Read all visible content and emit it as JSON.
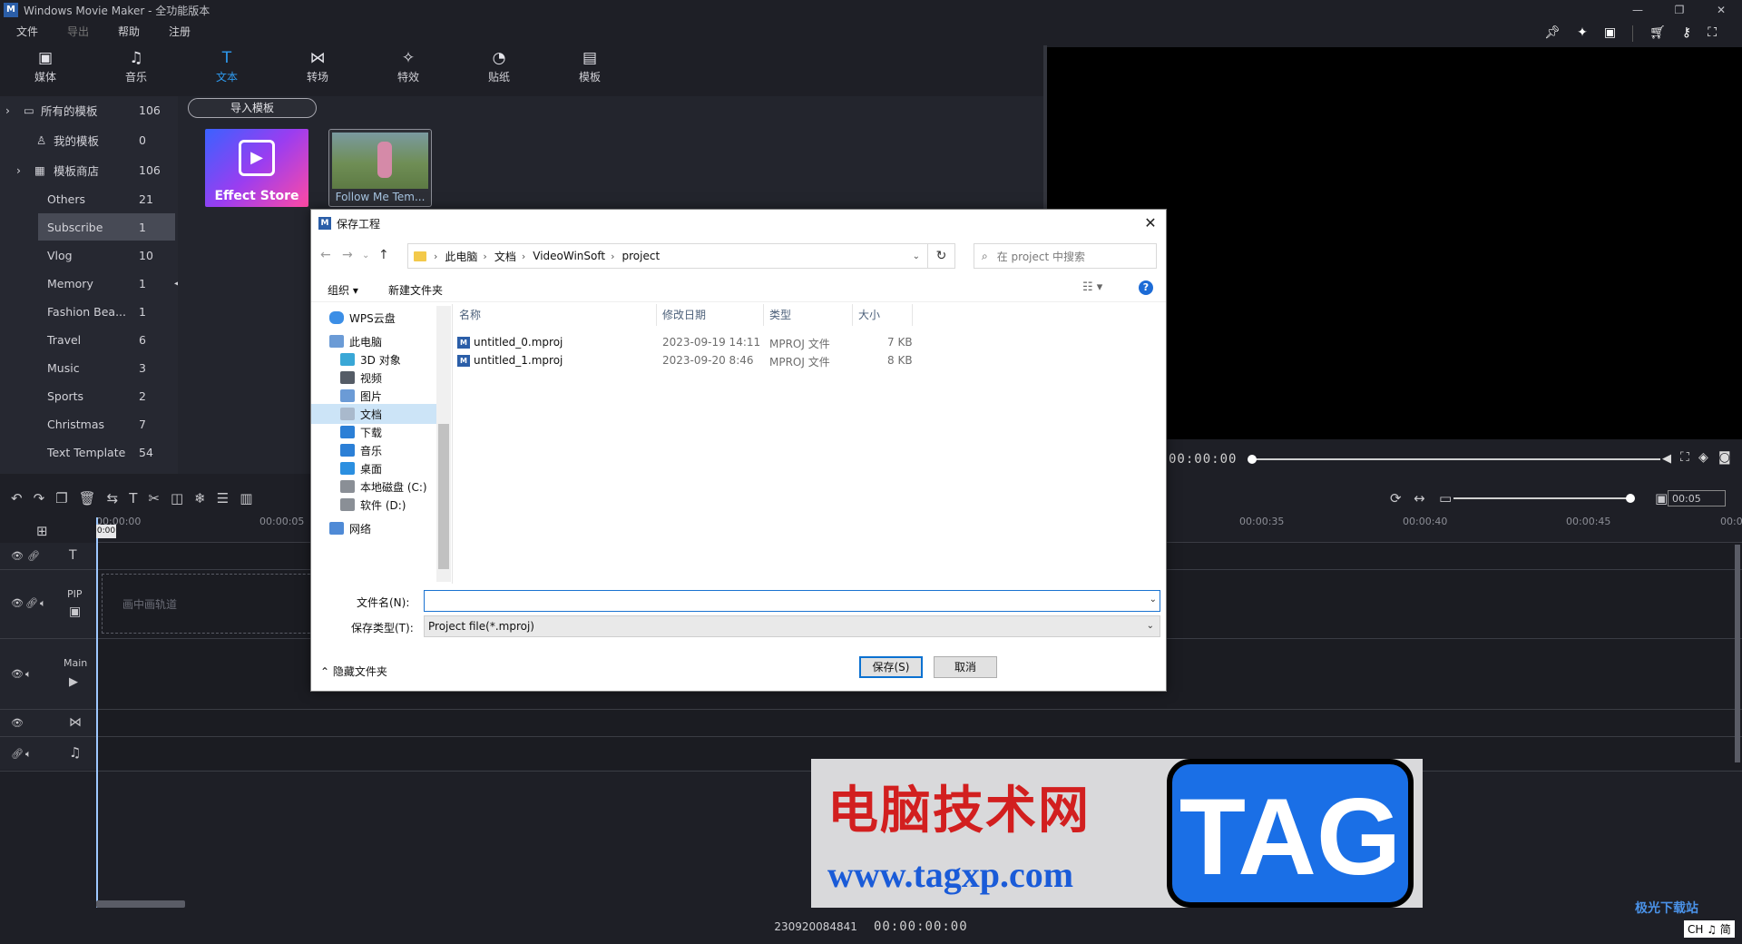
{
  "app": {
    "title": "Windows Movie Maker - 全功能版本",
    "logo": "M",
    "window_buttons": [
      "—",
      "❐",
      "✕"
    ]
  },
  "menu": [
    {
      "label": "文件",
      "enabled": true
    },
    {
      "label": "导出",
      "enabled": false
    },
    {
      "label": "帮助",
      "enabled": true
    },
    {
      "label": "注册",
      "enabled": true
    }
  ],
  "toolbar_icons": [
    "pin-icon",
    "sparkle-icon",
    "save-icon",
    "cart-icon",
    "key-icon",
    "screen-ratio-icon"
  ],
  "tabs": [
    {
      "label": "媒体",
      "icon": "▣",
      "active": false
    },
    {
      "label": "音乐",
      "icon": "♫",
      "active": false
    },
    {
      "label": "文本",
      "icon": "T",
      "active": true
    },
    {
      "label": "转场",
      "icon": "⋈",
      "active": false
    },
    {
      "label": "特效",
      "icon": "✧",
      "active": false
    },
    {
      "label": "贴纸",
      "icon": "◔",
      "active": false
    },
    {
      "label": "模板",
      "icon": "▤",
      "active": false
    }
  ],
  "sidebar": {
    "items": [
      {
        "label": "所有的模板",
        "count": "106",
        "expander": "›",
        "icon": "▭"
      },
      {
        "label": "我的模板",
        "count": "0",
        "expander": "",
        "icon": "♙"
      },
      {
        "label": "模板商店",
        "count": "106",
        "expander": "›",
        "icon": "▦"
      },
      {
        "label": "Others",
        "count": "21"
      },
      {
        "label": "Subscribe",
        "count": "1"
      },
      {
        "label": "Vlog",
        "count": "10"
      },
      {
        "label": "Memory",
        "count": "1"
      },
      {
        "label": "Fashion Bea...",
        "count": "1"
      },
      {
        "label": "Travel",
        "count": "6"
      },
      {
        "label": "Music",
        "count": "3"
      },
      {
        "label": "Sports",
        "count": "2"
      },
      {
        "label": "Christmas",
        "count": "7"
      },
      {
        "label": "Text Template",
        "count": "54"
      }
    ],
    "selected_index": 4
  },
  "content": {
    "import_button": "导入模板",
    "thumbnails": [
      {
        "caption": "Effect Store"
      },
      {
        "caption": "Follow Me Tem..."
      }
    ]
  },
  "preview": {
    "timecode": "00:00:00"
  },
  "timeline": {
    "ruler_labels": [
      "00:00:00",
      "00:00:05",
      "00:00:35",
      "00:00:40",
      "00:00:45",
      "00:0"
    ],
    "playhead_label": "0:00",
    "zoom_value": "00:05",
    "tracks": [
      {
        "label": "",
        "icon": "T"
      },
      {
        "label": "PIP",
        "icon": "▣",
        "placeholder": "画中画轨道"
      },
      {
        "label": "Main",
        "icon": "▶"
      },
      {
        "label": "",
        "icon": "⋈"
      },
      {
        "label": "",
        "icon": "♫"
      }
    ]
  },
  "statusbar": {
    "project_id": "230920084841",
    "timecode": "00:00:00:00"
  },
  "dialog": {
    "title": "保存工程",
    "close": "✕",
    "breadcrumbs": [
      "此电脑",
      "文档",
      "VideoWinSoft",
      "project"
    ],
    "search_placeholder": "在 project 中搜索",
    "organize": "组织 ▾",
    "new_folder": "新建文件夹",
    "nav_items": [
      {
        "label": "WPS云盘",
        "color": "#3b8ee6"
      },
      {
        "label": "此电脑",
        "color": "#6b9bd6"
      },
      {
        "label": "3D 对象",
        "color": "#39a7d6"
      },
      {
        "label": "视频",
        "color": "#555c66"
      },
      {
        "label": "图片",
        "color": "#6b9bd6"
      },
      {
        "label": "文档",
        "color": "#a9b9cc"
      },
      {
        "label": "下载",
        "color": "#2b7fd6"
      },
      {
        "label": "音乐",
        "color": "#2b7fd6"
      },
      {
        "label": "桌面",
        "color": "#2b8fe0"
      },
      {
        "label": "本地磁盘 (C:)",
        "color": "#8a8f96"
      },
      {
        "label": "软件 (D:)",
        "color": "#8a8f96"
      },
      {
        "label": "网络",
        "color": "#4f8ad6"
      }
    ],
    "nav_selected": 5,
    "columns": [
      "名称",
      "修改日期",
      "类型",
      "大小"
    ],
    "files": [
      {
        "name": "untitled_0.mproj",
        "date": "2023-09-19 14:11",
        "type": "MPROJ 文件",
        "size": "7 KB"
      },
      {
        "name": "untitled_1.mproj",
        "date": "2023-09-20 8:46",
        "type": "MPROJ 文件",
        "size": "8 KB"
      }
    ],
    "filename_label": "文件名(N):",
    "filename_value": "",
    "filetype_label": "保存类型(T):",
    "filetype_value": "Project file(*.mproj)",
    "hide_folders": "隐藏文件夹",
    "save_button": "保存(S)",
    "cancel_button": "取消"
  },
  "watermark": {
    "cn_text": "电脑技术网",
    "url": "www.tagxp.com",
    "tag": "TAG",
    "badge_text": "极光下载站",
    "ch_text": "CH ♫ 简"
  }
}
